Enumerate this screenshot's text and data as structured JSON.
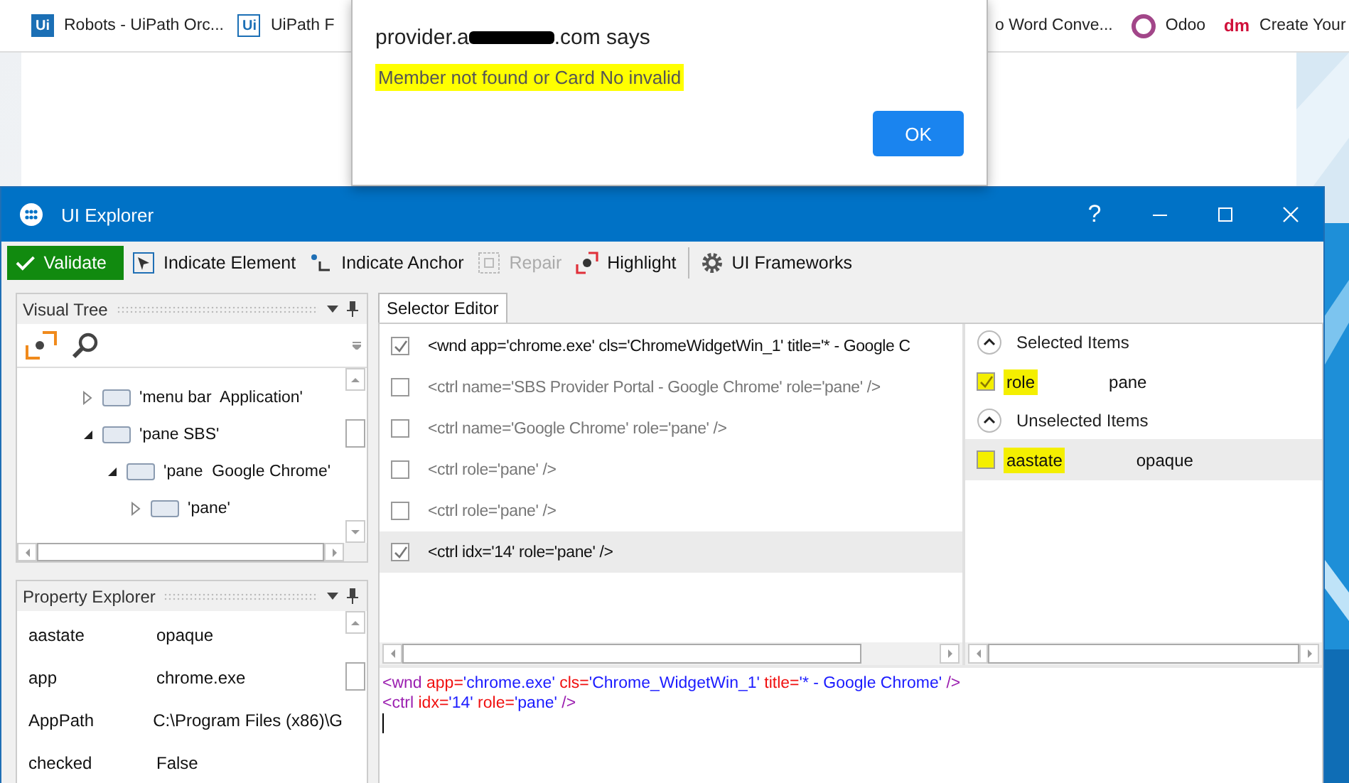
{
  "browser": {
    "bookmarks_left": [
      {
        "label": "Robots - UiPath Orc...",
        "kind": "filled",
        "badge": "Ui"
      },
      {
        "label": "UiPath F",
        "kind": "outline",
        "badge": "Ui"
      }
    ],
    "bookmarks_right": [
      {
        "label": "o Word Conve...",
        "kind": "plain"
      },
      {
        "label": "Odoo",
        "kind": "ring"
      },
      {
        "label": "Create Your",
        "kind": "mark",
        "badge": "dm"
      }
    ]
  },
  "dialog": {
    "title_start": "provider.a",
    "title_end": ".com says",
    "redacted": true,
    "message": "Member not found or Card No invalid",
    "message_highlighted": true,
    "button": "OK"
  },
  "window": {
    "title": "UI Explorer",
    "help": "?"
  },
  "toolbar": [
    {
      "label": "Validate",
      "kind": "primary",
      "disabled": false
    },
    {
      "label": "Indicate Element",
      "kind": "tool",
      "disabled": false
    },
    {
      "label": "Indicate Anchor",
      "kind": "tool",
      "disabled": false
    },
    {
      "label": "Repair",
      "kind": "tool",
      "disabled": true
    },
    {
      "label": "Highlight",
      "kind": "tool",
      "disabled": false
    },
    {
      "label": "UI Frameworks",
      "kind": "tool",
      "disabled": false
    }
  ],
  "visual_tree": {
    "title": "Visual Tree",
    "items": [
      {
        "label": "'menu bar  Application'",
        "expanded": false
      },
      {
        "label": "'pane SBS'",
        "expanded": true,
        "children": [
          {
            "label": "'pane  Google Chrome'",
            "expanded": true,
            "children": [
              {
                "label": "'pane'",
                "expanded": false
              }
            ]
          }
        ]
      }
    ]
  },
  "property_explorer": {
    "title": "Property Explorer",
    "rows": [
      {
        "name": "aastate",
        "value": "opaque"
      },
      {
        "name": "app",
        "value": "chrome.exe"
      },
      {
        "name": "AppPath",
        "value": "C:\\Program Files (x86)\\G"
      },
      {
        "name": "checked",
        "value": "False"
      }
    ]
  },
  "selector_editor": {
    "tab": "Selector Editor",
    "tab_selected": true,
    "rows": [
      {
        "text": "<wnd app='chrome.exe' cls='ChromeWidgetWin_1' title='* - Google C",
        "checked": true,
        "selected": false
      },
      {
        "text": "<ctrl name='SBS Provider Portal - Google Chrome' role='pane' />",
        "checked": false,
        "selected": false
      },
      {
        "text": "<ctrl name='Google Chrome' role='pane' />",
        "checked": false,
        "selected": false
      },
      {
        "text": "<ctrl role='pane' />",
        "checked": false,
        "selected": false
      },
      {
        "text": "<ctrl role='pane' />",
        "checked": false,
        "selected": false
      },
      {
        "text": "<ctrl idx='14' role='pane' />",
        "checked": true,
        "selected": true
      }
    ]
  },
  "attributes": {
    "sections": [
      {
        "title": "Selected Items",
        "expanded": true,
        "items": [
          {
            "name": "role",
            "value": "pane",
            "checked": true,
            "selected": false,
            "highlighted": true
          }
        ]
      },
      {
        "title": "Unselected Items",
        "expanded": true,
        "items": [
          {
            "name": "aastate",
            "value": "opaque",
            "checked": false,
            "selected": true,
            "highlighted": true
          }
        ]
      }
    ]
  },
  "editor": {
    "lines": [
      [
        {
          "t": "<wnd ",
          "kind": "tag"
        },
        {
          "t": "app=",
          "kind": "attr"
        },
        {
          "t": "'chrome.exe'",
          "kind": "value"
        },
        {
          "t": " cls=",
          "kind": "attr"
        },
        {
          "t": "'Chrome_WidgetWin_1'",
          "kind": "value"
        },
        {
          "t": " title=",
          "kind": "attr"
        },
        {
          "t": "'* - Google Chrome'",
          "kind": "value"
        },
        {
          "t": " />",
          "kind": "tag"
        }
      ],
      [
        {
          "t": "<ctrl ",
          "kind": "tag"
        },
        {
          "t": "idx=",
          "kind": "attr"
        },
        {
          "t": "'14'",
          "kind": "value"
        },
        {
          "t": " role=",
          "kind": "attr"
        },
        {
          "t": "'pane'",
          "kind": "value"
        },
        {
          "t": " />",
          "kind": "tag"
        }
      ]
    ]
  }
}
